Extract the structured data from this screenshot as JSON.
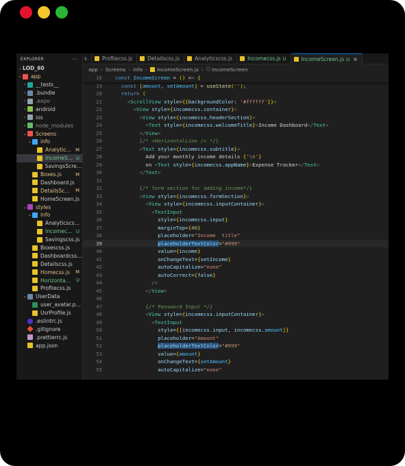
{
  "window": {
    "dots": [
      "close",
      "minimize",
      "maximize"
    ],
    "colors": {
      "close": "#e5142e",
      "minimize": "#f3c72a",
      "maximize": "#2bb534"
    }
  },
  "sidebar": {
    "title": "EXPLORER",
    "menu": "···",
    "items": [
      {
        "label": "LOD_60",
        "badge": ""
      },
      {
        "label": "app",
        "badge": ""
      },
      {
        "label": "__tests__",
        "badge": ""
      },
      {
        "label": ".bundle",
        "badge": ""
      },
      {
        "label": ".expo",
        "badge": ""
      },
      {
        "label": "android",
        "badge": ""
      },
      {
        "label": "ios",
        "badge": ""
      },
      {
        "label": "node_modules",
        "badge": ""
      },
      {
        "label": "Screens",
        "badge": ""
      },
      {
        "label": "info",
        "badge": ""
      },
      {
        "label": "Analytic...",
        "badge": "M"
      },
      {
        "label": "IncomeS...",
        "badge": "U"
      },
      {
        "label": "SavingsScree...",
        "badge": ""
      },
      {
        "label": "Boxes.js",
        "badge": "M"
      },
      {
        "label": "Dashboard.js",
        "badge": ""
      },
      {
        "label": "DetailsSc...",
        "badge": "M"
      },
      {
        "label": "HomeScreen.js",
        "badge": ""
      },
      {
        "label": "styles",
        "badge": ""
      },
      {
        "label": "info",
        "badge": ""
      },
      {
        "label": "Analyticscss.js",
        "badge": ""
      },
      {
        "label": "Incomec...",
        "badge": "U"
      },
      {
        "label": "Savingscss.js",
        "badge": ""
      },
      {
        "label": "Boxescss.js",
        "badge": ""
      },
      {
        "label": "Dashboardcss.js",
        "badge": ""
      },
      {
        "label": "Detailscss.js",
        "badge": ""
      },
      {
        "label": "Homecss.js",
        "badge": "M"
      },
      {
        "label": "Horizonta...",
        "badge": "U"
      },
      {
        "label": "Profilecss.js",
        "badge": ""
      },
      {
        "label": "UserData",
        "badge": ""
      },
      {
        "label": "user_avatar.png",
        "badge": ""
      },
      {
        "label": "UsrProfile.js",
        "badge": ""
      },
      {
        "label": ".eslintrc.js",
        "badge": ""
      },
      {
        "label": ".gitignore",
        "badge": ""
      },
      {
        "label": ".prettierrc.js",
        "badge": ""
      },
      {
        "label": "app.json",
        "badge": ""
      }
    ]
  },
  "tabs": [
    {
      "label": "s",
      "flag": ""
    },
    {
      "label": "Profilecss.js",
      "flag": ""
    },
    {
      "label": "Detailscss.js",
      "flag": ""
    },
    {
      "label": "Analyticscss.js",
      "flag": ""
    },
    {
      "label": "Incomecss.js",
      "flag": "U"
    },
    {
      "label": "IncomeScreen.js",
      "flag": "U",
      "close": "×"
    }
  ],
  "breadcrumb": {
    "parts": [
      "app",
      "Screens",
      "info",
      "IncomeScreen.js",
      "IncomeScreen"
    ]
  },
  "code": {
    "lines": [
      {
        "n": "16",
        "text": "  const IncomeScreen = () => {"
      },
      {
        "n": "19",
        "text": "    const [amount, setAmount] = useState('');"
      },
      {
        "n": "20",
        "text": "    return ("
      },
      {
        "n": "21",
        "text": "      <ScrollView style={{backgroundColor: '#ffffff'}}>"
      },
      {
        "n": "22",
        "text": "        <View style={incomecss.container}>"
      },
      {
        "n": "23",
        "text": "          <View style={incomecss.headerSection}>"
      },
      {
        "n": "24",
        "text": "            <Text style={incomecss.welcomeTitle}>Income Dashboard</Text>"
      },
      {
        "n": "25",
        "text": "          </View>"
      },
      {
        "n": "26",
        "text": "          {/* <HorizontalLine /> */}"
      },
      {
        "n": "27",
        "text": "          <Text style={incomecss.subtitle}>"
      },
      {
        "n": "28",
        "text": "            Add your monthly income details {'\\n'}"
      },
      {
        "n": "29",
        "text": "            on <Text style={incomecss.appName}>Expense Tracker</Text>"
      },
      {
        "n": "30",
        "text": "          </Text>"
      },
      {
        "n": "31",
        "text": ""
      },
      {
        "n": "32",
        "text": "          {/* form section for adding income*/}"
      },
      {
        "n": "33",
        "text": "          <View style={incomecss.formSection}>"
      },
      {
        "n": "34",
        "text": "            <View style={incomecss.inputContainer}>"
      },
      {
        "n": "35",
        "text": "              <TextInput"
      },
      {
        "n": "36",
        "text": "                style={incomecss.input}"
      },
      {
        "n": "37",
        "text": "                marginTop={40}"
      },
      {
        "n": "38",
        "text": "                placeholder=\"Income  title\""
      },
      {
        "n": "39",
        "text": "                placeholderTextColor=\"#999\""
      },
      {
        "n": "40",
        "text": "                value={income}"
      },
      {
        "n": "41",
        "text": "                onChangeText={setIncome}"
      },
      {
        "n": "42",
        "text": "                autoCapitalize=\"none\""
      },
      {
        "n": "43",
        "text": "                autoCorrect={false}"
      },
      {
        "n": "44",
        "text": "              />"
      },
      {
        "n": "45",
        "text": "            </View>"
      },
      {
        "n": "46",
        "text": ""
      },
      {
        "n": "47",
        "text": "            {/* Password Input */}"
      },
      {
        "n": "48",
        "text": "            <View style={incomecss.inputContainer}>"
      },
      {
        "n": "49",
        "text": "              <TextInput"
      },
      {
        "n": "50",
        "text": "                style={[incomecss.input, incomecss.amount]}"
      },
      {
        "n": "51",
        "text": "                placeholder=\"Amount\""
      },
      {
        "n": "52",
        "text": "                placeholderTextColor=\"#999\""
      },
      {
        "n": "53",
        "text": "                value={amount}"
      },
      {
        "n": "54",
        "text": "                onChangeText={setAmount}"
      },
      {
        "n": "55",
        "text": "                autoCapitalize=\"none\""
      }
    ]
  }
}
